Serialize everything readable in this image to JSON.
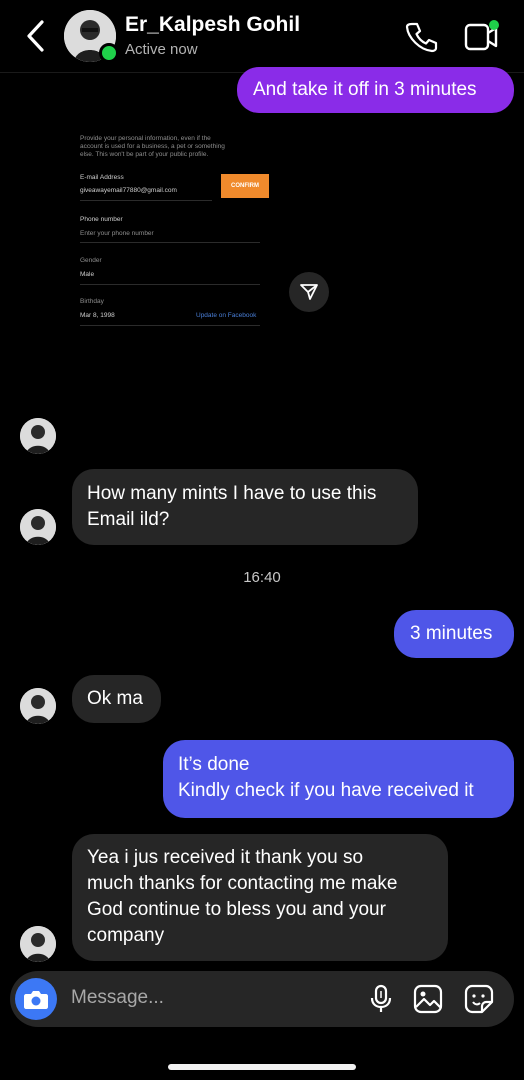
{
  "header": {
    "name": "Er_Kalpesh Gohil",
    "status": "Active now"
  },
  "messages": [
    {
      "text": "And take it off in 3 minutes"
    },
    {
      "text": "How many mints I have to use this\nEmail ild?"
    },
    {
      "text": "3 minutes"
    },
    {
      "text": "Ok ma"
    },
    {
      "text": "It’s done\nKindly check if you have received it"
    },
    {
      "text": "Yea  i jus received it thank you so\nmuch thanks for contacting me make\nGod continue to bless you and your\ncompany"
    }
  ],
  "timestamp": "16:40",
  "shared_screenshot": {
    "intro": "Provide your personal information, even if the\naccount is used for a business, a pet or something\nelse. This won't be part of your public profile.",
    "email_label": "E-mail Address",
    "email_value": "giveawayemail77880@gmail.com",
    "confirm_label": "CONFIRM",
    "phone_label": "Phone number",
    "phone_placeholder": "Enter your phone number",
    "gender_label": "Gender",
    "gender_value": "Male",
    "birthday_label": "Birthday",
    "birthday_value": "Mar 8, 1998",
    "update_link": "Update on Facebook"
  },
  "composer": {
    "placeholder": "Message..."
  },
  "colors": {
    "purple_bubble": "#8a2ce8",
    "blue_bubble": "#4f56e8",
    "incoming_bubble": "#262626",
    "online": "#1fd04a",
    "camera": "#3c78f5",
    "confirm": "#f08a2c"
  }
}
